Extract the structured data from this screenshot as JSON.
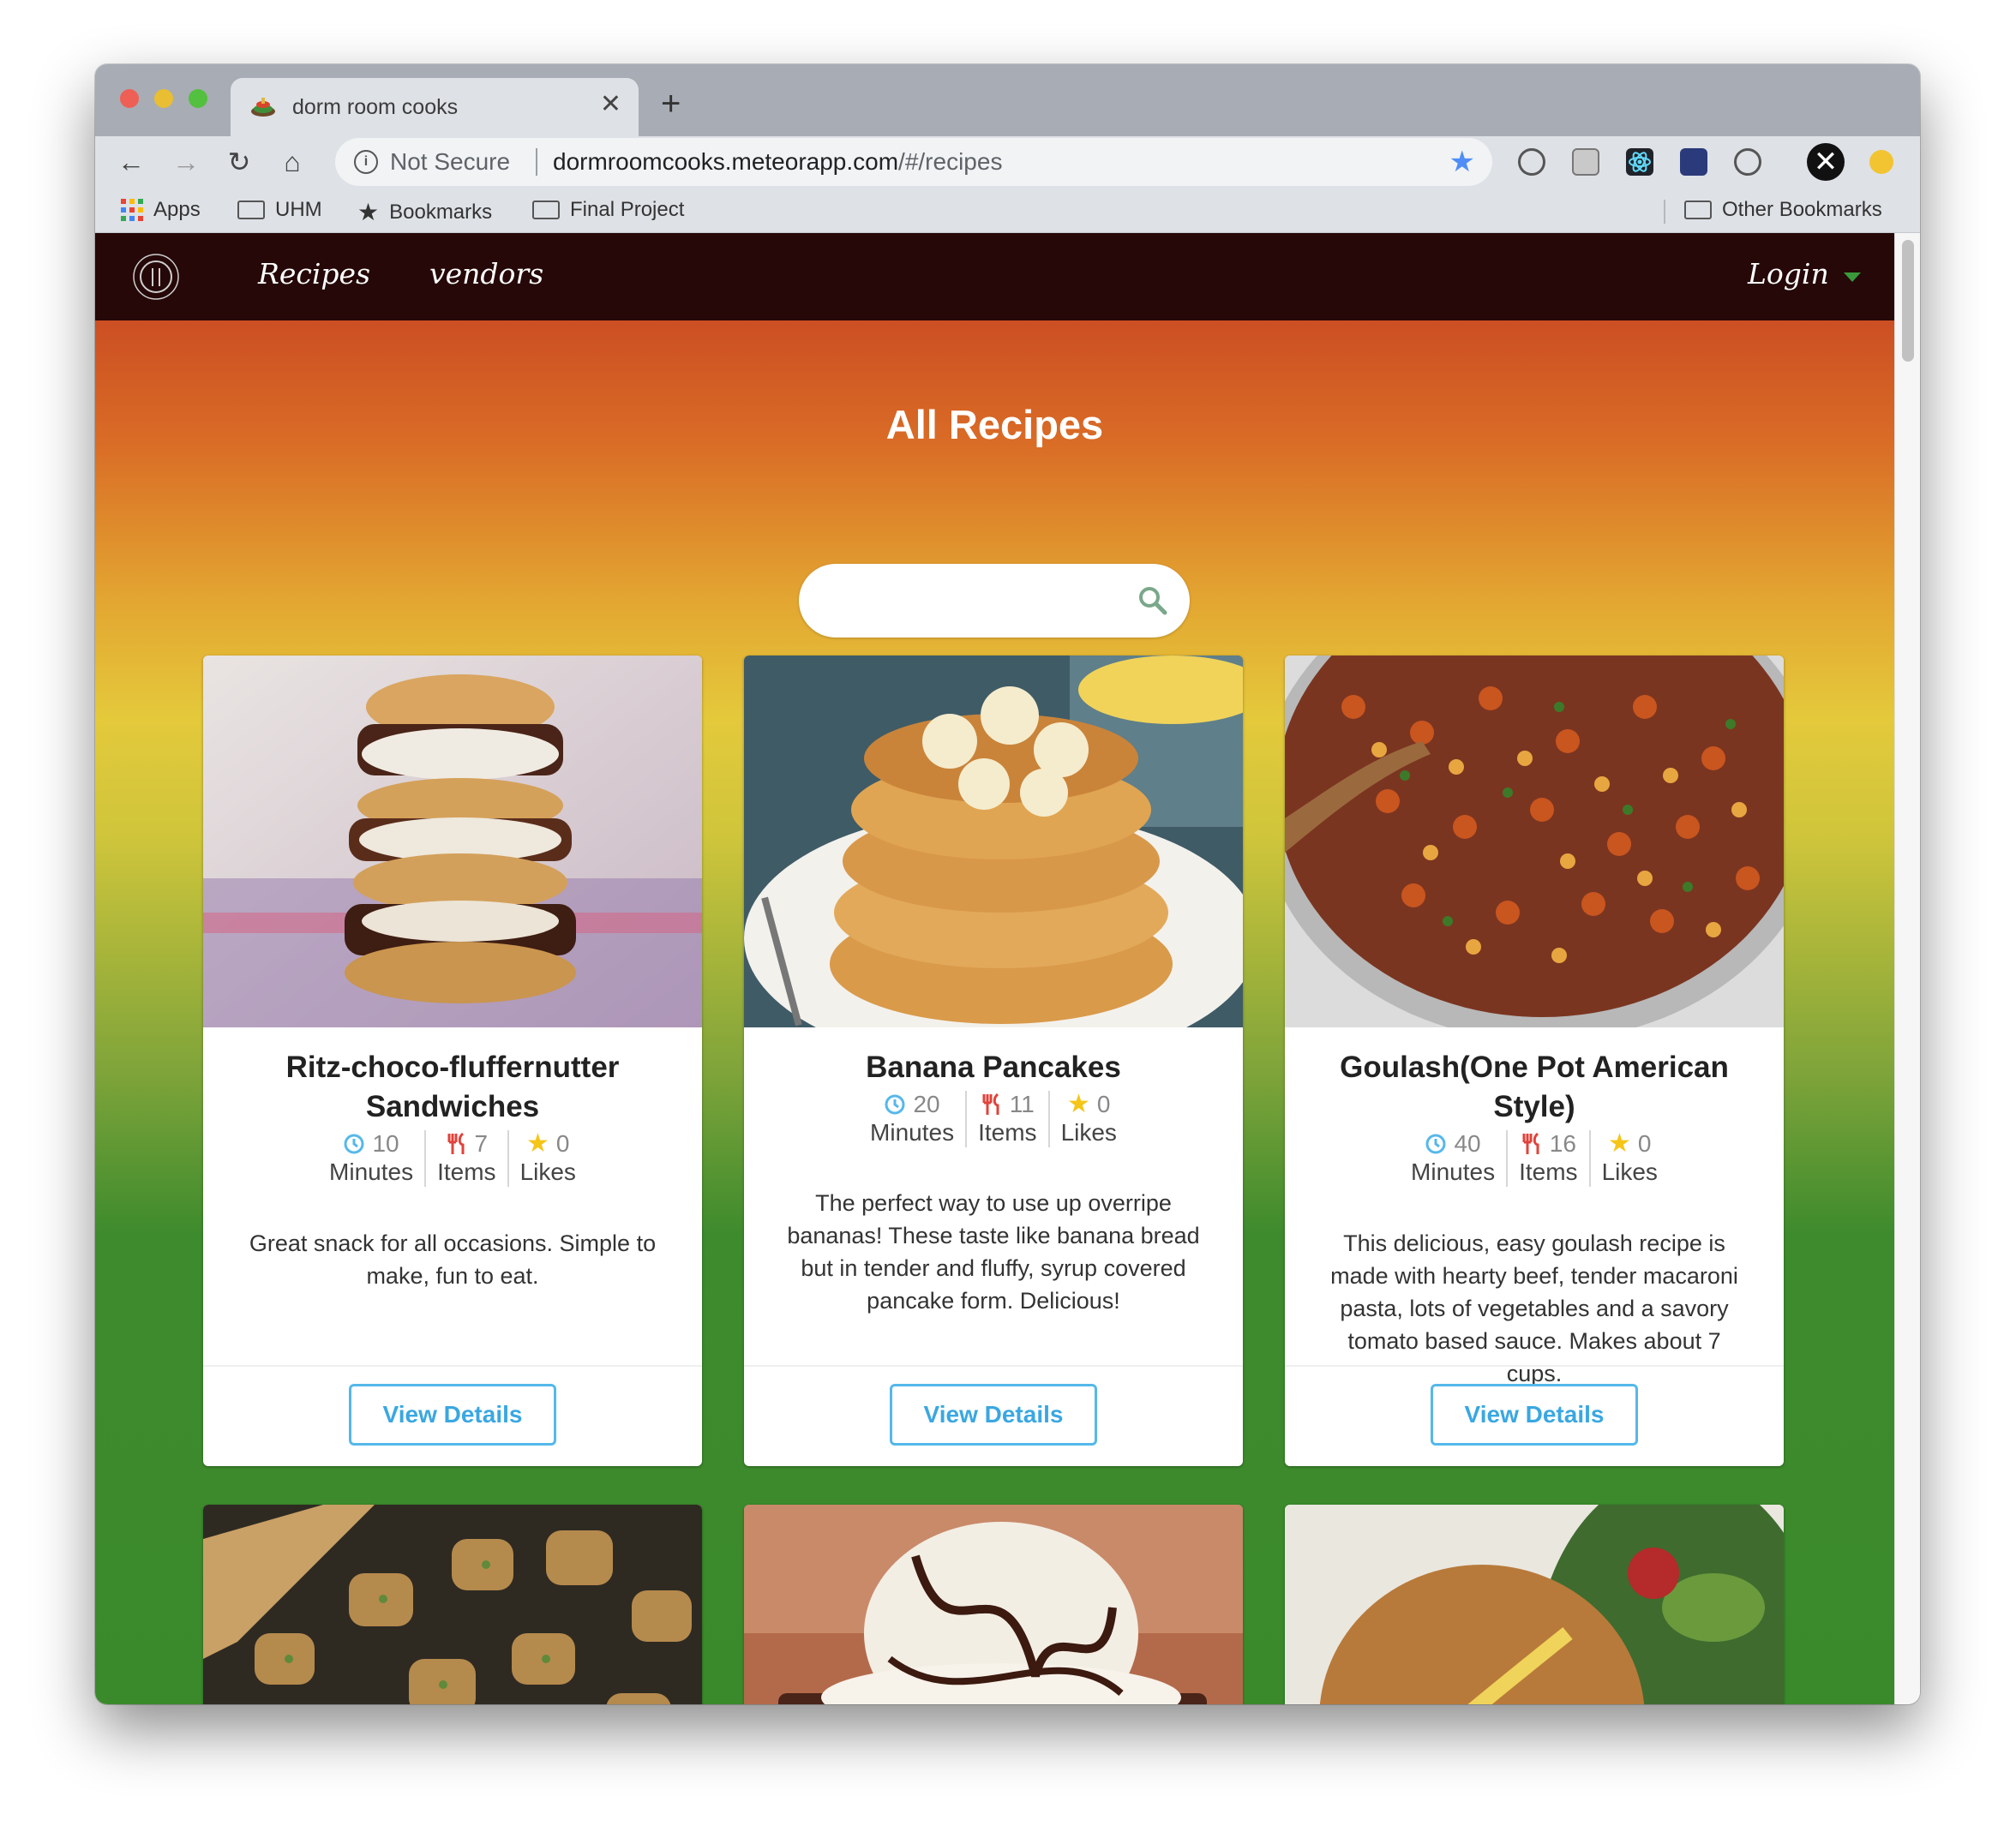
{
  "browser": {
    "tab_title": "dorm room cooks",
    "not_secure": "Not Secure",
    "url_domain": "dormroomcooks.meteorapp.com",
    "url_path": "/#/recipes",
    "bookmarks": [
      "Apps",
      "UHM",
      "Bookmarks",
      "Final Project"
    ],
    "other_bookmarks": "Other Bookmarks"
  },
  "nav": {
    "links": [
      "Recipes",
      "vendors"
    ],
    "login": "Login"
  },
  "page": {
    "title": "All Recipes",
    "search_placeholder": ""
  },
  "recipes": [
    {
      "title": "Ritz-choco-fluffernutter Sandwiches",
      "minutes": "10",
      "minutes_label": "Minutes",
      "items": "7",
      "items_label": "Items",
      "likes": "0",
      "likes_label": "Likes",
      "description": "Great snack for all occasions. Simple to make, fun to eat.",
      "button": "View Details"
    },
    {
      "title": "Banana Pancakes",
      "minutes": "20",
      "minutes_label": "Minutes",
      "items": "11",
      "items_label": "Items",
      "likes": "0",
      "likes_label": "Likes",
      "description": "The perfect way to use up overripe bananas! These taste like banana bread but in tender and fluffy, syrup covered pancake form. Delicious!",
      "button": "View Details"
    },
    {
      "title": "Goulash(One Pot American Style)",
      "minutes": "40",
      "minutes_label": "Minutes",
      "items": "16",
      "items_label": "Items",
      "likes": "0",
      "likes_label": "Likes",
      "description": "This delicious, easy goulash recipe is made with hearty beef, tender macaroni pasta, lots of vegetables and a savory tomato based sauce. Makes about 7 cups.",
      "button": "View Details"
    }
  ],
  "colors": {
    "nav_bg": "#250807",
    "accent_button": "#3aa7e2",
    "gradient_top": "#c23a21",
    "gradient_mid": "#e4c93b",
    "gradient_bottom": "#3a8a2b"
  }
}
